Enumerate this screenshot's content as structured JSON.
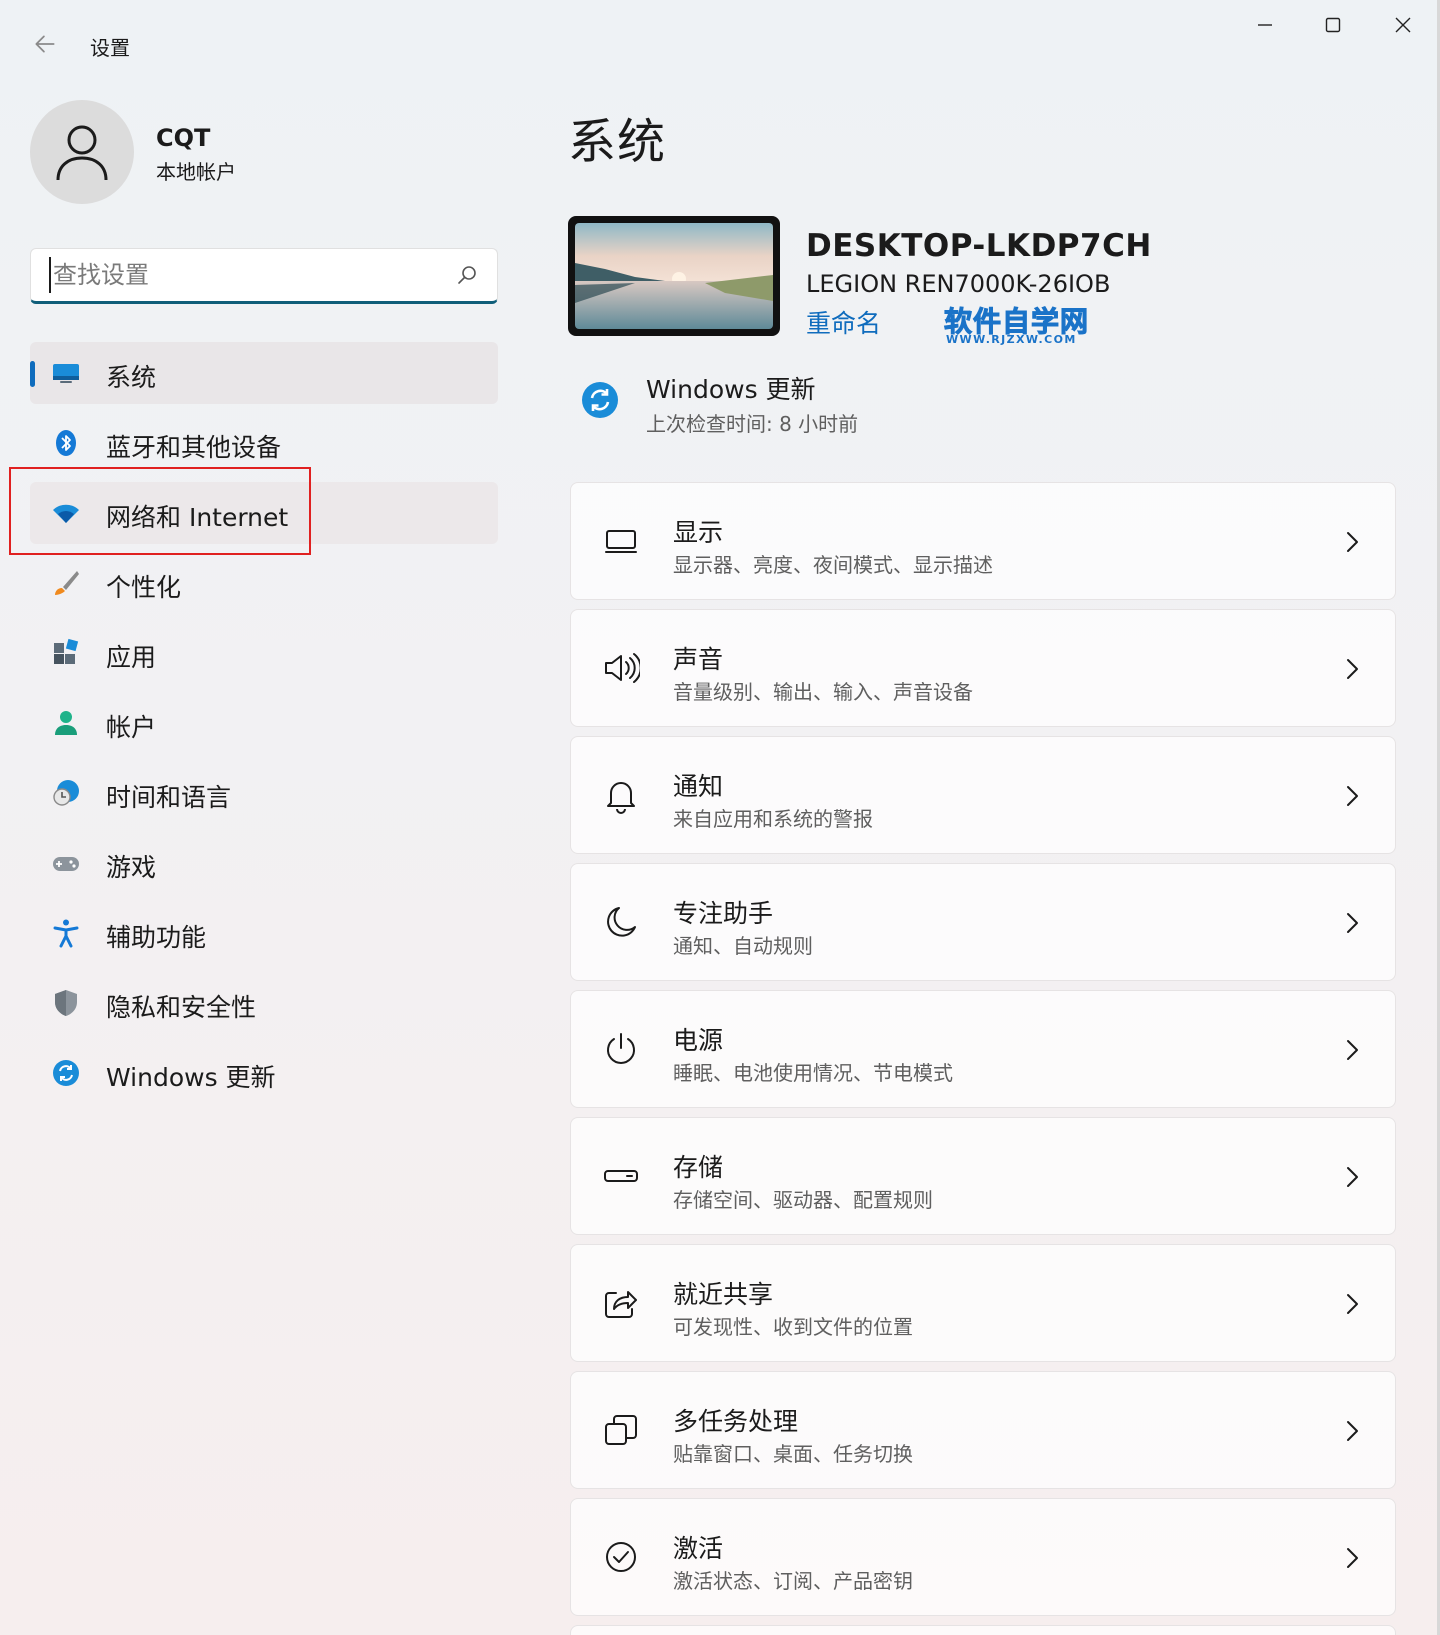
{
  "titlebar": {
    "title": "设置"
  },
  "profile": {
    "name": "CQT",
    "account_type": "本地帐户"
  },
  "search": {
    "placeholder": "查找设置"
  },
  "sidebar": {
    "items": [
      {
        "label": "系统",
        "icon": "display-icon",
        "state": "selected"
      },
      {
        "label": "蓝牙和其他设备",
        "icon": "bluetooth-icon"
      },
      {
        "label": "网络和 Internet",
        "icon": "wifi-icon",
        "state": "hovered"
      },
      {
        "label": "个性化",
        "icon": "brush-icon"
      },
      {
        "label": "应用",
        "icon": "apps-icon"
      },
      {
        "label": "帐户",
        "icon": "person-icon"
      },
      {
        "label": "时间和语言",
        "icon": "globe-clock-icon"
      },
      {
        "label": "游戏",
        "icon": "gamepad-icon"
      },
      {
        "label": "辅助功能",
        "icon": "accessibility-icon"
      },
      {
        "label": "隐私和安全性",
        "icon": "shield-icon"
      },
      {
        "label": "Windows 更新",
        "icon": "update-icon"
      }
    ]
  },
  "main": {
    "title": "系统",
    "device": {
      "name": "DESKTOP-LKDP7CH",
      "model": "LEGION REN7000K-26IOB",
      "rename": "重命名"
    },
    "watermark": {
      "main": "软件自学网",
      "sub": "WWW.RJZXW.COM"
    },
    "update": {
      "title": "Windows 更新",
      "subtitle": "上次检查时间: 8 小时前"
    },
    "cards": [
      {
        "title": "显示",
        "subtitle": "显示器、亮度、夜间模式、显示描述",
        "icon": "monitor-icon"
      },
      {
        "title": "声音",
        "subtitle": "音量级别、输出、输入、声音设备",
        "icon": "speaker-icon"
      },
      {
        "title": "通知",
        "subtitle": "来自应用和系统的警报",
        "icon": "bell-icon"
      },
      {
        "title": "专注助手",
        "subtitle": "通知、自动规则",
        "icon": "moon-icon"
      },
      {
        "title": "电源",
        "subtitle": "睡眠、电池使用情况、节电模式",
        "icon": "power-icon"
      },
      {
        "title": "存储",
        "subtitle": "存储空间、驱动器、配置规则",
        "icon": "storage-icon"
      },
      {
        "title": "就近共享",
        "subtitle": "可发现性、收到文件的位置",
        "icon": "share-icon"
      },
      {
        "title": "多任务处理",
        "subtitle": "贴靠窗口、桌面、任务切换",
        "icon": "multitask-icon"
      },
      {
        "title": "激活",
        "subtitle": "激活状态、订阅、产品密钥",
        "icon": "check-circle-icon"
      }
    ]
  },
  "colors": {
    "accent": "#0f6cbd",
    "highlight_box": "#e02020",
    "watermark": "#1a73c8"
  }
}
